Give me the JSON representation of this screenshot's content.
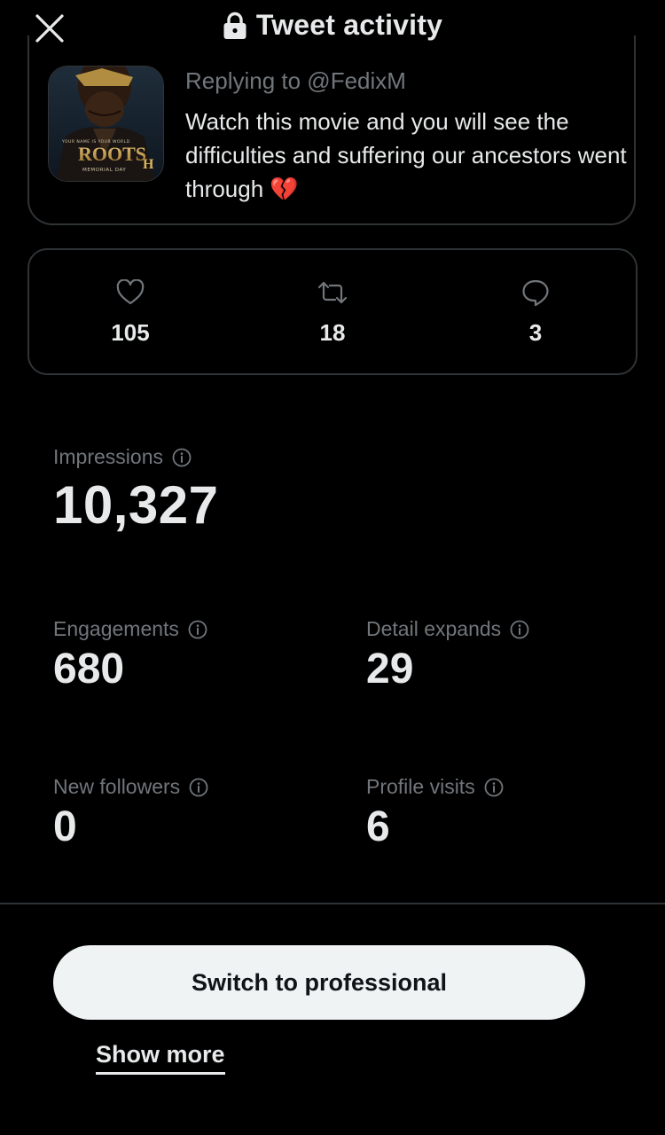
{
  "header": {
    "title": "Tweet activity",
    "close_icon": "close-icon",
    "lock_icon": "lock-icon"
  },
  "tweet": {
    "replying_to": "Replying to @FedixM",
    "text": "Watch this movie and you will see the difficulties and suffering our ancestors went through",
    "emoji": "💔",
    "cover_image": {
      "title_text": "ROOTS",
      "tagline": "YOUR NAME IS YOUR WORLD",
      "subtitle": "MEMORIAL DAY",
      "network_mark": "H"
    }
  },
  "counts": {
    "likes": "105",
    "retweets": "18",
    "replies": "3"
  },
  "metrics": {
    "impressions": {
      "label": "Impressions",
      "value": "10,327"
    },
    "engagements": {
      "label": "Engagements",
      "value": "680"
    },
    "detail_expands": {
      "label": "Detail expands",
      "value": "29"
    },
    "new_followers": {
      "label": "New followers",
      "value": "0"
    },
    "profile_visits": {
      "label": "Profile visits",
      "value": "6"
    }
  },
  "actions": {
    "switch_professional": "Switch to professional",
    "show_more": "Show more"
  },
  "colors": {
    "background": "#000000",
    "text_primary": "#e7e9ea",
    "text_secondary": "#71767b",
    "border": "#2f3336",
    "button_bg": "#eff3f4",
    "button_text": "#0f1419",
    "broken_heart": "#e0245e"
  }
}
